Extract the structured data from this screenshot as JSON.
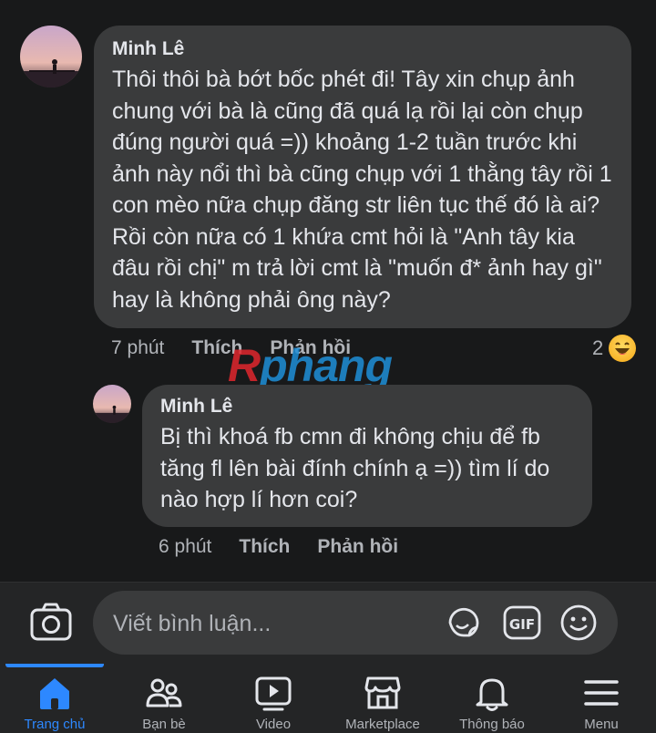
{
  "comments": [
    {
      "author": "Minh Lê",
      "text": "Thôi thôi bà bớt bốc phét đi! Tây xin chụp ảnh chung với bà là cũng đã quá lạ rồi lại còn chụp đúng người quá =)) khoảng 1-2 tuần trước khi ảnh này nổi thì bà cũng chụp với 1 thằng tây rồi 1 con mèo nữa chụp đăng str liên tục thế đó là ai? Rồi còn nữa có 1 khứa cmt hỏi là \"Anh tây kia đâu rồi chị\" m trả lời cmt là \"muốn đ* ảnh hay gì\" hay là không phải ông này?",
      "time": "7 phút",
      "like_label": "Thích",
      "reply_label": "Phản hồi",
      "reaction_count": "2",
      "reaction_icon": "haha-emoji-icon"
    },
    {
      "author": "Minh Lê",
      "text": "Bị thì khoá fb cmn đi không chịu để fb tăng fl lên bài đính chính ạ =)) tìm lí do nào hợp lí hơn coi?",
      "time": "6 phút",
      "like_label": "Thích",
      "reply_label": "Phản hồi"
    }
  ],
  "watermark": {
    "red": "R",
    "blue": "phang"
  },
  "composer": {
    "placeholder": "Viết bình luận...",
    "icons": [
      "camera-icon",
      "sticker-icon",
      "gif-icon",
      "emoji-icon"
    ]
  },
  "nav": {
    "items": [
      {
        "label": "Trang chủ",
        "icon": "home-icon",
        "active": true
      },
      {
        "label": "Bạn bè",
        "icon": "friends-icon"
      },
      {
        "label": "Video",
        "icon": "video-icon"
      },
      {
        "label": "Marketplace",
        "icon": "marketplace-icon"
      },
      {
        "label": "Thông báo",
        "icon": "bell-icon"
      },
      {
        "label": "Menu",
        "icon": "menu-icon"
      }
    ]
  },
  "colors": {
    "background": "#18191a",
    "bubble": "#3a3b3c",
    "text": "#e4e6eb",
    "secondary_text": "#b0b3b8",
    "accent": "#2d88ff"
  }
}
